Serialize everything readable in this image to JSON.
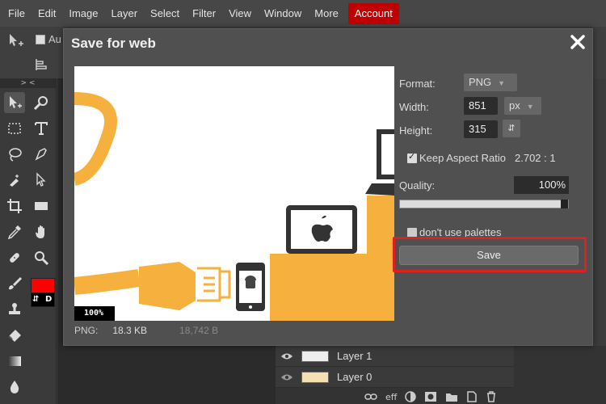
{
  "menu": {
    "items": [
      "File",
      "Edit",
      "Image",
      "Layer",
      "Select",
      "Filter",
      "View",
      "Window",
      "More"
    ],
    "account": "Account"
  },
  "options": {
    "auto_label": "Au"
  },
  "toolbar": {
    "collapse_label": "> <",
    "swap_label": "⇵",
    "default_label": "D"
  },
  "colors": {
    "foreground": "#ff0000",
    "background": "#000000",
    "accent": "#c00000",
    "highlight": "#e02020"
  },
  "dialog": {
    "title": "Save for web",
    "format_label": "Format:",
    "format_value": "PNG",
    "width_label": "Width:",
    "width_value": "851",
    "unit_value": "px",
    "height_label": "Height:",
    "height_value": "315",
    "swap_icon": "⇵",
    "keep_aspect_label": "Keep Aspect Ratio",
    "aspect_value": "2.702 : 1",
    "quality_label": "Quality:",
    "quality_value": "100%",
    "quality_fraction": 1.0,
    "palettes_label": "don't use palettes",
    "save_label": "Save",
    "zoom_label": "100%",
    "size_format": "PNG:",
    "size_kb": "18.3 KB",
    "size_bytes": "18,742 B"
  },
  "layers": {
    "rows": [
      {
        "name": "Layer 1"
      },
      {
        "name": "Layer 0"
      }
    ],
    "footer_eff": "eff"
  }
}
